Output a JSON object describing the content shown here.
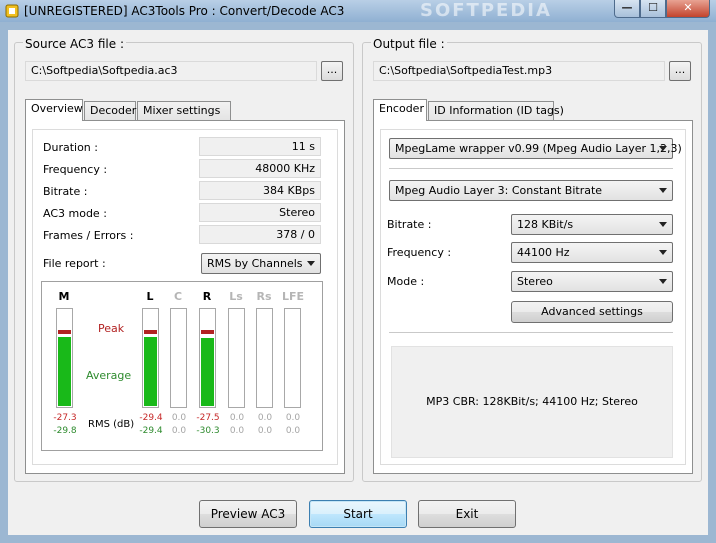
{
  "window": {
    "title": "[UNREGISTERED] AC3Tools Pro : Convert/Decode AC3",
    "controls": {
      "minimize": "—",
      "maximize": "☐",
      "close": "✕"
    },
    "watermark": "SOFTPEDIA"
  },
  "source": {
    "group_label": "Source AC3 file :",
    "path": "C:\\Softpedia\\Softpedia.ac3",
    "browse_label": "..."
  },
  "output": {
    "group_label": "Output file :",
    "path": "C:\\Softpedia\\SoftpediaTest.mp3",
    "browse_label": "..."
  },
  "left_tabs": [
    {
      "label": "Overview",
      "active": true
    },
    {
      "label": "Decoder",
      "active": false
    },
    {
      "label": "Mixer settings",
      "active": false
    }
  ],
  "overview": {
    "stats": [
      {
        "label": "Duration :",
        "value": "11 s"
      },
      {
        "label": "Frequency :",
        "value": "48000 KHz"
      },
      {
        "label": "Bitrate :",
        "value": "384 KBps"
      },
      {
        "label": "AC3 mode :",
        "value": "Stereo"
      },
      {
        "label": "Frames / Errors :",
        "value": "378 / 0"
      }
    ],
    "file_report_label": "File report :",
    "file_report_value": "RMS by Channels",
    "meters": {
      "legend_peak": "Peak",
      "legend_average": "Average",
      "legend_rms": "RMS (dB)",
      "channels": [
        {
          "name": "M",
          "active": true,
          "peak_db": "-27.3",
          "rms_db": "-29.8",
          "level": 0.7,
          "peak_level": 0.74
        },
        {
          "name": "L",
          "active": true,
          "peak_db": "-29.4",
          "rms_db": "-29.4",
          "level": 0.7,
          "peak_level": 0.74
        },
        {
          "name": "C",
          "active": false,
          "peak_db": "0.0",
          "rms_db": "0.0",
          "level": 0,
          "peak_level": 0
        },
        {
          "name": "R",
          "active": true,
          "peak_db": "-27.5",
          "rms_db": "-30.3",
          "level": 0.69,
          "peak_level": 0.74
        },
        {
          "name": "Ls",
          "active": false,
          "peak_db": "0.0",
          "rms_db": "0.0",
          "level": 0,
          "peak_level": 0
        },
        {
          "name": "Rs",
          "active": false,
          "peak_db": "0.0",
          "rms_db": "0.0",
          "level": 0,
          "peak_level": 0
        },
        {
          "name": "LFE",
          "active": false,
          "peak_db": "0.0",
          "rms_db": "0.0",
          "level": 0,
          "peak_level": 0
        }
      ]
    }
  },
  "right_tabs": [
    {
      "label": "Encoder",
      "active": true
    },
    {
      "label": "ID Information (ID tags)",
      "active": false
    }
  ],
  "encoder": {
    "wrapper": "MpegLame wrapper v0.99 (Mpeg Audio Layer 1,2,3)",
    "layer_mode": "Mpeg Audio Layer 3: Constant Bitrate",
    "bitrate_label": "Bitrate :",
    "bitrate_value": "128 KBit/s",
    "frequency_label": "Frequency :",
    "frequency_value": "44100 Hz",
    "mode_label": "Mode :",
    "mode_value": "Stereo",
    "advanced_label": "Advanced settings",
    "summary": "MP3 CBR: 128KBit/s; 44100 Hz; Stereo"
  },
  "buttons": {
    "preview": "Preview AC3",
    "start": "Start",
    "exit": "Exit"
  },
  "colors": {
    "average": "#19b919",
    "peak": "#b22222"
  }
}
